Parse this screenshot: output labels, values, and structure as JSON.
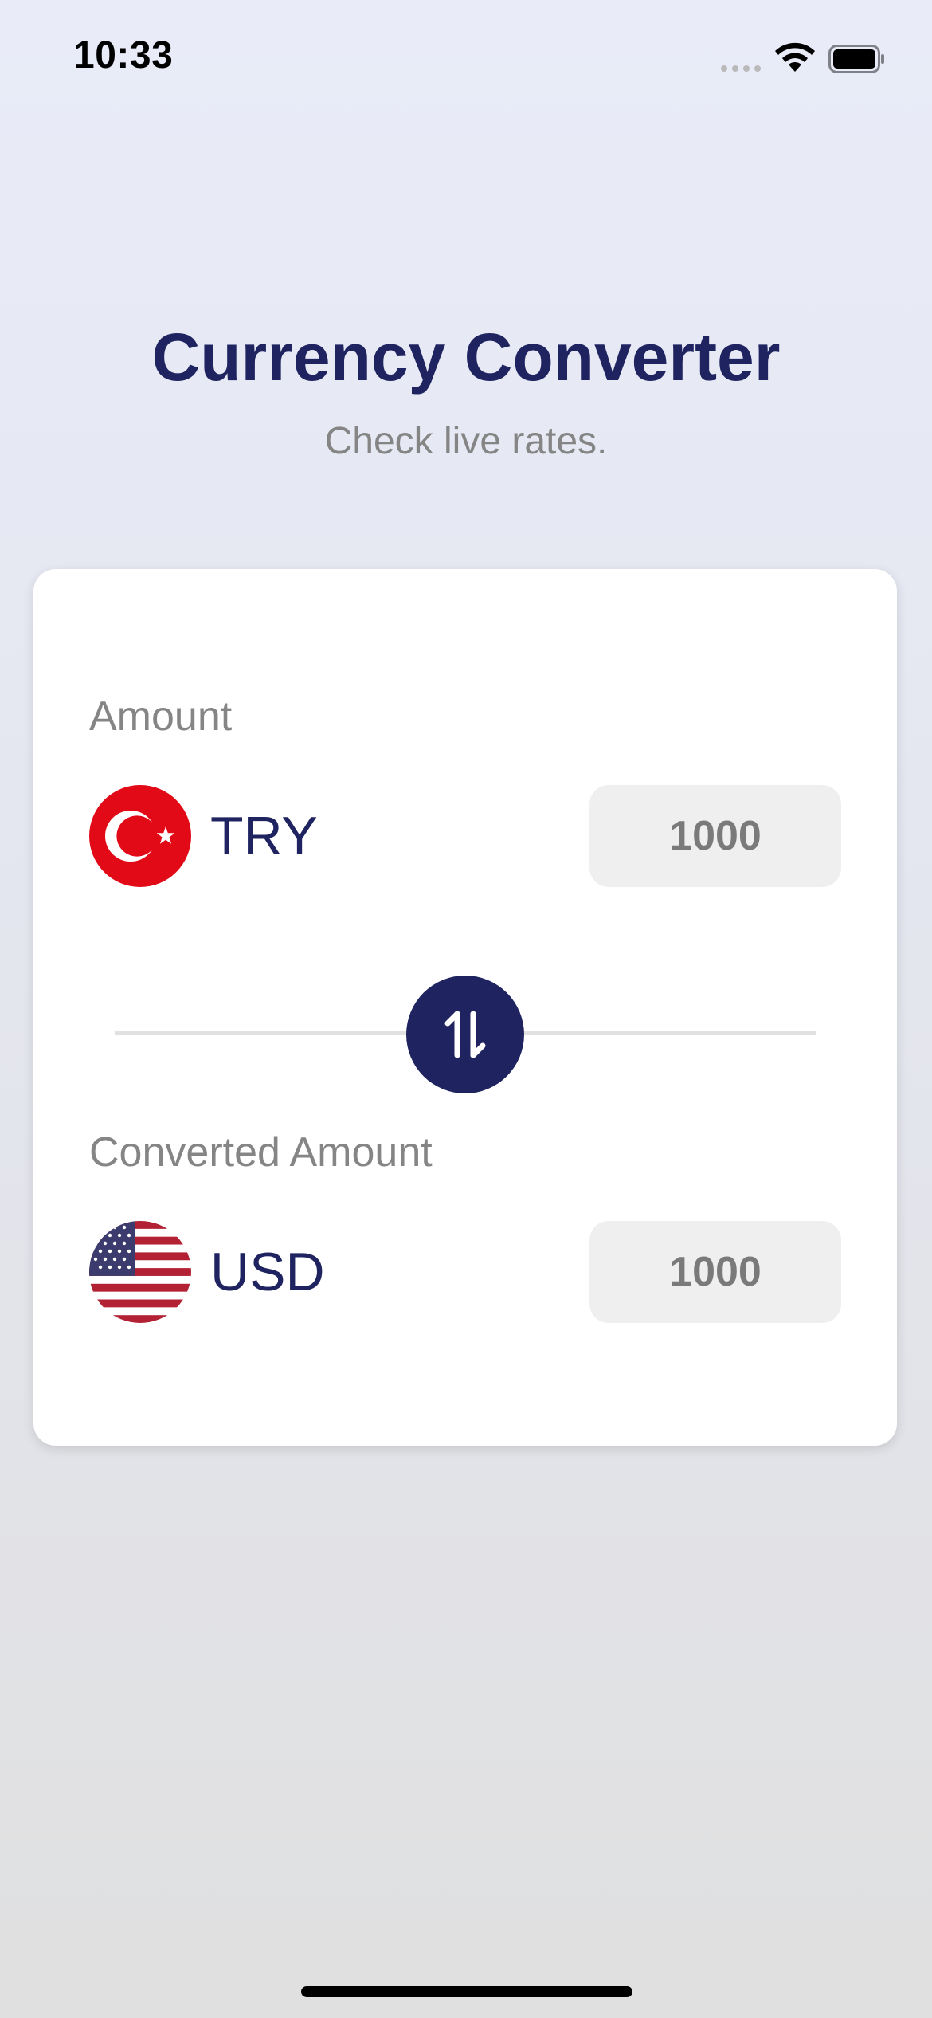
{
  "status_bar": {
    "time": "10:33",
    "signal_icon": "cellular-signal-icon",
    "wifi_icon": "wifi-icon",
    "battery_icon": "battery-icon"
  },
  "header": {
    "title": "Currency Converter",
    "subtitle": "Check live rates."
  },
  "converter": {
    "from": {
      "label": "Amount",
      "currency_code": "TRY",
      "flag_icon": "turkey-flag-icon",
      "amount_value": "1000"
    },
    "swap_icon": "swap-arrows-icon",
    "to": {
      "label": "Converted Amount",
      "currency_code": "USD",
      "flag_icon": "usa-flag-icon",
      "amount_value": "1000"
    }
  },
  "colors": {
    "primary": "#1f2461",
    "label_gray": "#858585",
    "input_bg": "#efefef",
    "turkey_red": "#e30a17",
    "usa_red": "#b22234",
    "usa_blue": "#3c3b6e"
  }
}
